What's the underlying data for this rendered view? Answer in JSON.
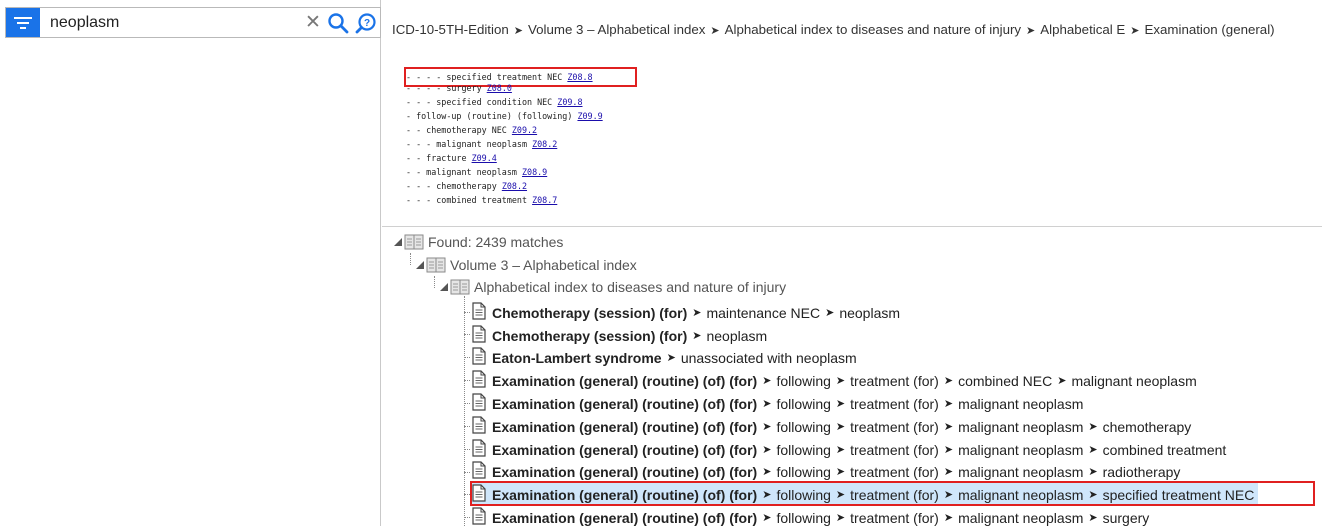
{
  "search": {
    "query": "neoplasm"
  },
  "breadcrumb": [
    "ICD-10-5TH-Edition",
    "Volume 3 – Alphabetical index",
    "Alphabetical index to diseases and nature of injury",
    "Alphabetical E",
    "Examination (general)"
  ],
  "document_lines": [
    {
      "text": "- - - - specified treatment NEC",
      "code": "Z08.8"
    },
    {
      "text": "- - - - surgery",
      "code": "Z08.0"
    },
    {
      "text": "- - - specified condition NEC",
      "code": "Z09.8"
    },
    {
      "text": "- follow-up (routine) (following)",
      "code": "Z09.9"
    },
    {
      "text": "- - chemotherapy NEC",
      "code": "Z09.2"
    },
    {
      "text": "- - - malignant neoplasm",
      "code": "Z08.2"
    },
    {
      "text": "- - fracture",
      "code": "Z09.4"
    },
    {
      "text": "- - malignant neoplasm",
      "code": "Z08.9"
    },
    {
      "text": "- - - chemotherapy",
      "code": "Z08.2"
    },
    {
      "text": "- - - combined treatment",
      "code": "Z08.7"
    }
  ],
  "tree": {
    "root": "Found: 2439 matches",
    "volume": "Volume 3 – Alphabetical index",
    "section": "Alphabetical index to diseases and nature of injury",
    "results": [
      {
        "term": "Chemotherapy (session) (for)",
        "path": [
          "maintenance NEC",
          "neoplasm"
        ]
      },
      {
        "term": "Chemotherapy (session) (for)",
        "path": [
          "neoplasm"
        ]
      },
      {
        "term": "Eaton-Lambert syndrome",
        "path": [
          "unassociated with neoplasm"
        ]
      },
      {
        "term": "Examination (general) (routine) (of) (for)",
        "path": [
          "following",
          "treatment (for)",
          "combined NEC",
          "malignant neoplasm"
        ]
      },
      {
        "term": "Examination (general) (routine) (of) (for)",
        "path": [
          "following",
          "treatment (for)",
          "malignant neoplasm"
        ]
      },
      {
        "term": "Examination (general) (routine) (of) (for)",
        "path": [
          "following",
          "treatment (for)",
          "malignant neoplasm",
          "chemotherapy"
        ]
      },
      {
        "term": "Examination (general) (routine) (of) (for)",
        "path": [
          "following",
          "treatment (for)",
          "malignant neoplasm",
          "combined treatment"
        ]
      },
      {
        "term": "Examination (general) (routine) (of) (for)",
        "path": [
          "following",
          "treatment (for)",
          "malignant neoplasm",
          "radiotherapy"
        ]
      },
      {
        "term": "Examination (general) (routine) (of) (for)",
        "path": [
          "following",
          "treatment (for)",
          "malignant neoplasm",
          "specified treatment NEC"
        ],
        "selected": true
      },
      {
        "term": "Examination (general) (routine) (of) (for)",
        "path": [
          "following",
          "treatment (for)",
          "malignant neoplasm",
          "surgery"
        ]
      }
    ]
  },
  "colors": {
    "accent": "#1a73e8",
    "highlight": "#e02020",
    "selection": "#cfe6fb",
    "link": "#1a0dab"
  },
  "icons": {
    "menu": "filter-menu-icon",
    "clear": "close-icon",
    "search": "search-icon",
    "advanced": "search-advanced-icon",
    "folder": "book-folder-icon",
    "document": "document-icon"
  }
}
